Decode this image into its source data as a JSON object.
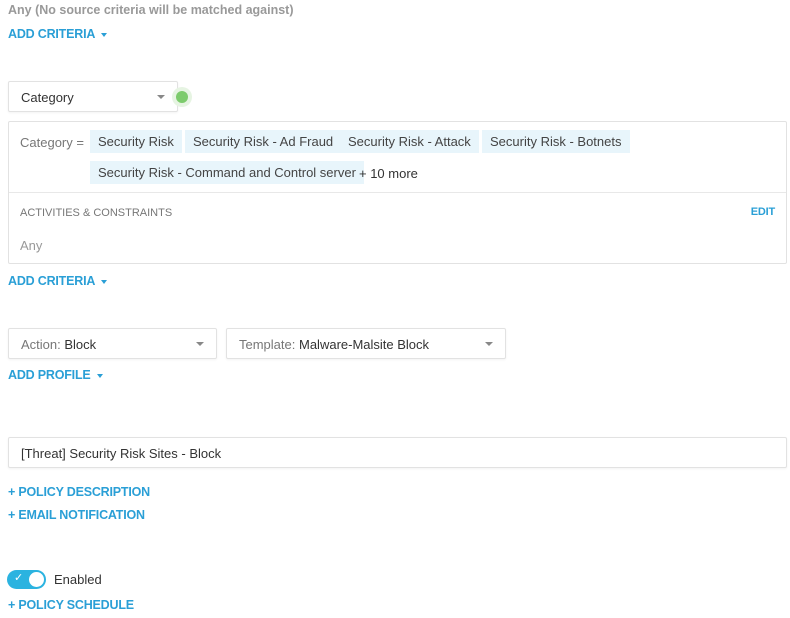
{
  "source": {
    "any_text": "Any (No source criteria will be matched against)",
    "add_criteria": "ADD CRITERIA"
  },
  "destination": {
    "type_select": "Category",
    "status_color": "#7ccb6c",
    "criteria_label": "Category =",
    "chips": [
      "Security Risk",
      "Security Risk - Ad Fraud",
      "Security Risk - Attack",
      "Security Risk - Botnets",
      "Security Risk - Command and Control server"
    ],
    "more": "+ 10 more",
    "activities_label": "ACTIVITIES & CONSTRAINTS",
    "edit": "EDIT",
    "activities_value": "Any",
    "add_criteria": "ADD CRITERIA"
  },
  "profile": {
    "action_label": "Action:",
    "action_value": "Block",
    "template_label": "Template:",
    "template_value": "Malware-Malsite Block",
    "add_profile": "ADD PROFILE"
  },
  "policy": {
    "name": "[Threat] Security Risk Sites - Block",
    "add_description": "+ POLICY DESCRIPTION",
    "add_email": "+ EMAIL NOTIFICATION",
    "enabled_label": "Enabled",
    "enabled": true,
    "add_schedule": "+ POLICY SCHEDULE"
  },
  "colors": {
    "accent": "#2a9fd6",
    "toggle": "#2bb3e0"
  }
}
